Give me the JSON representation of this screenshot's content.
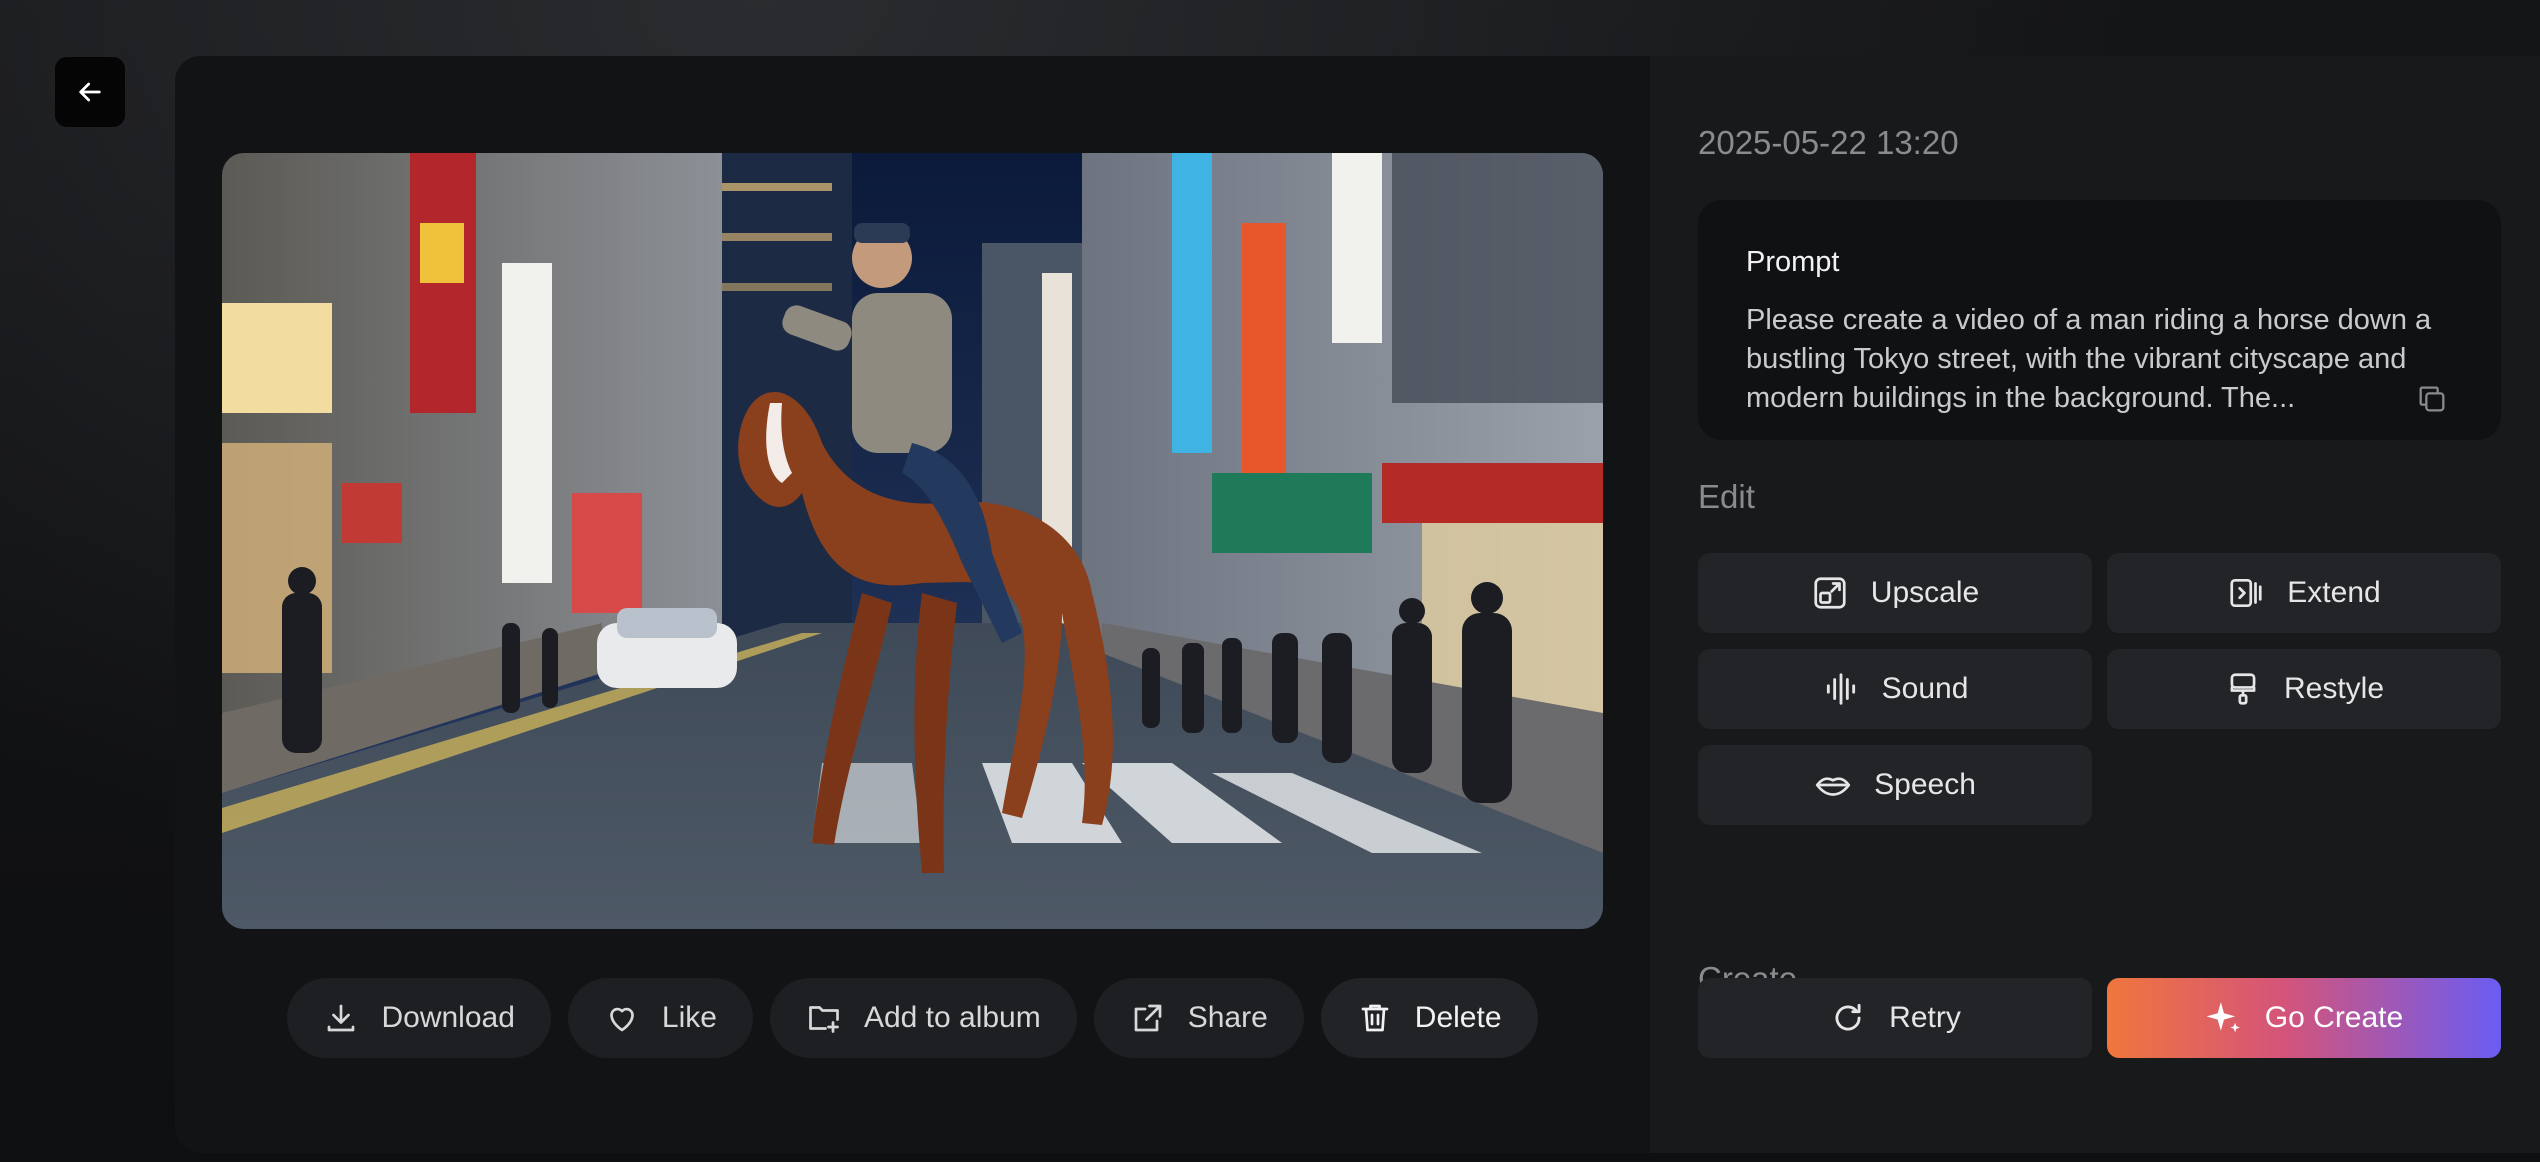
{
  "viewer": {
    "actions": {
      "download": "Download",
      "like": "Like",
      "add_to_album": "Add to album",
      "share": "Share",
      "delete": "Delete"
    }
  },
  "sidebar": {
    "timestamp": "2025-05-22 13:20",
    "prompt": {
      "title": "Prompt",
      "text": "Please create a video of a man riding a horse down a bustling Tokyo street, with the vibrant cityscape and modern buildings in the background. The..."
    },
    "edit": {
      "label": "Edit",
      "upscale": "Upscale",
      "extend": "Extend",
      "sound": "Sound",
      "restyle": "Restyle",
      "speech": "Speech"
    },
    "create": {
      "label": "Create",
      "retry": "Retry",
      "go_create": "Go Create"
    }
  },
  "colors": {
    "accent_gradient_start": "#f0763d",
    "accent_gradient_end": "#6a5cf3",
    "panel_bg": "#121315",
    "sidebar_bg": "#18191b"
  }
}
